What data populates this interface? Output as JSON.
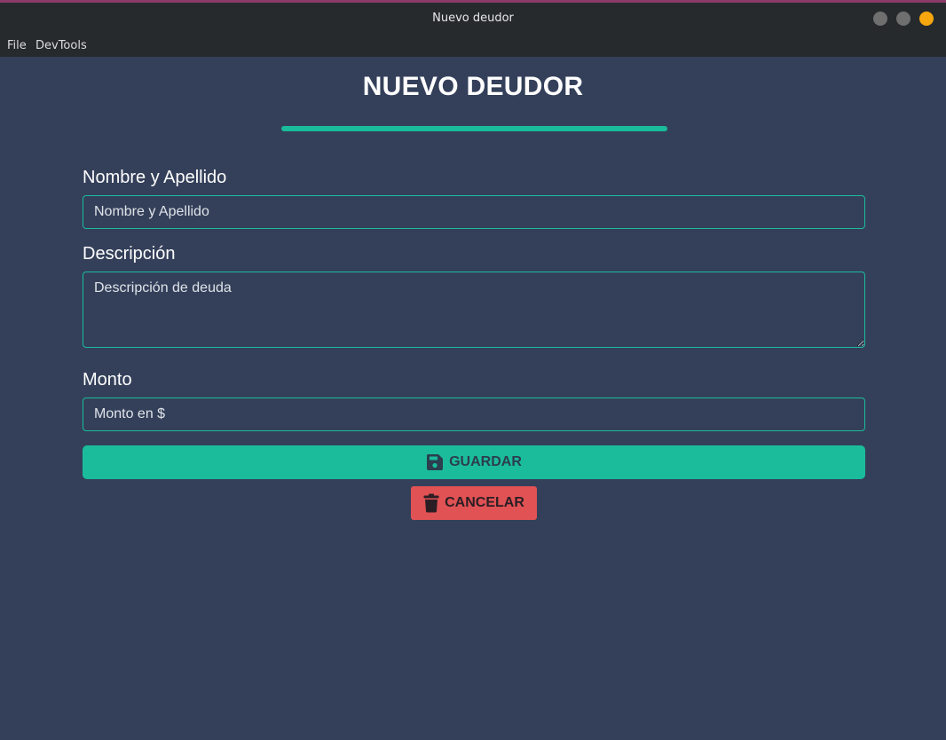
{
  "window": {
    "title": "Nuevo deudor"
  },
  "menu": {
    "items": [
      "File",
      "DevTools"
    ]
  },
  "page": {
    "heading": "NUEVO DEUDOR"
  },
  "form": {
    "name": {
      "label": "Nombre y Apellido",
      "placeholder": "Nombre y Apellido",
      "value": ""
    },
    "description": {
      "label": "Descripción",
      "placeholder": "Descripción de deuda",
      "value": ""
    },
    "amount": {
      "label": "Monto",
      "placeholder": "Monto en $",
      "value": ""
    }
  },
  "buttons": {
    "save": {
      "label": "GUARDAR",
      "icon": "floppy-disk-icon"
    },
    "cancel": {
      "label": "CANCELAR",
      "icon": "trash-icon"
    }
  },
  "colors": {
    "background": "#34405a",
    "accent": "#1abc9c",
    "danger": "#e05254",
    "titlebar": "#262a2d",
    "window_close": "#f6a70d"
  }
}
